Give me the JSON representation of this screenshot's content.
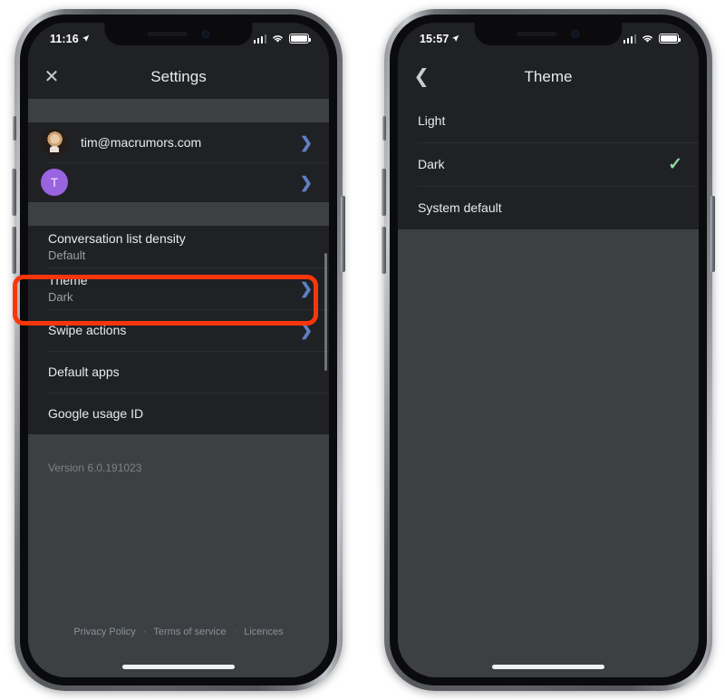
{
  "page": {
    "background": "#ffffff"
  },
  "colors": {
    "screen_bg": "#202124",
    "section_bg": "#3c4043",
    "accent_chevron": "#5f7fc4",
    "checkmark": "#8ed99a",
    "highlight": "#f9360b",
    "avatar_letter_bg": "#9a63e0"
  },
  "phones": [
    {
      "id": "settings-phone",
      "status_bar": {
        "time": "11:16",
        "location_icon": "location-arrow-icon",
        "signal_icon": "cellular-signal-icon",
        "wifi_icon": "wifi-icon",
        "battery_icon": "battery-icon"
      },
      "app_bar": {
        "nav_icon": "close-icon",
        "nav_glyph": "✕",
        "title": "Settings"
      },
      "accounts": [
        {
          "avatar_type": "photo",
          "avatar_letter": "",
          "label": "tim@macrumors.com",
          "chevron": "❯"
        },
        {
          "avatar_type": "letter",
          "avatar_letter": "T",
          "label": "",
          "chevron": "❯"
        }
      ],
      "settings_items": [
        {
          "label": "Conversation list density",
          "value": "Default",
          "chevron": "",
          "highlighted": false
        },
        {
          "label": "Theme",
          "value": "Dark",
          "chevron": "❯",
          "highlighted": true
        },
        {
          "label": "Swipe actions",
          "value": "",
          "chevron": "❯",
          "highlighted": false
        },
        {
          "label": "Default apps",
          "value": "",
          "chevron": "",
          "highlighted": false
        },
        {
          "label": "Google usage ID",
          "value": "",
          "chevron": "",
          "highlighted": false
        }
      ],
      "version": "Version 6.0.191023",
      "footer": {
        "links": [
          "Privacy Policy",
          "Terms of service",
          "Licences"
        ],
        "separator": "·"
      }
    },
    {
      "id": "theme-phone",
      "status_bar": {
        "time": "15:57",
        "location_icon": "location-arrow-icon",
        "signal_icon": "cellular-signal-icon",
        "wifi_icon": "wifi-icon",
        "battery_icon": "battery-icon"
      },
      "app_bar": {
        "nav_icon": "back-chevron-icon",
        "nav_glyph": "❮",
        "title": "Theme"
      },
      "theme_options": [
        {
          "label": "Light",
          "selected": false,
          "check": ""
        },
        {
          "label": "Dark",
          "selected": true,
          "check": "✓"
        },
        {
          "label": "System default",
          "selected": false,
          "check": ""
        }
      ]
    }
  ]
}
